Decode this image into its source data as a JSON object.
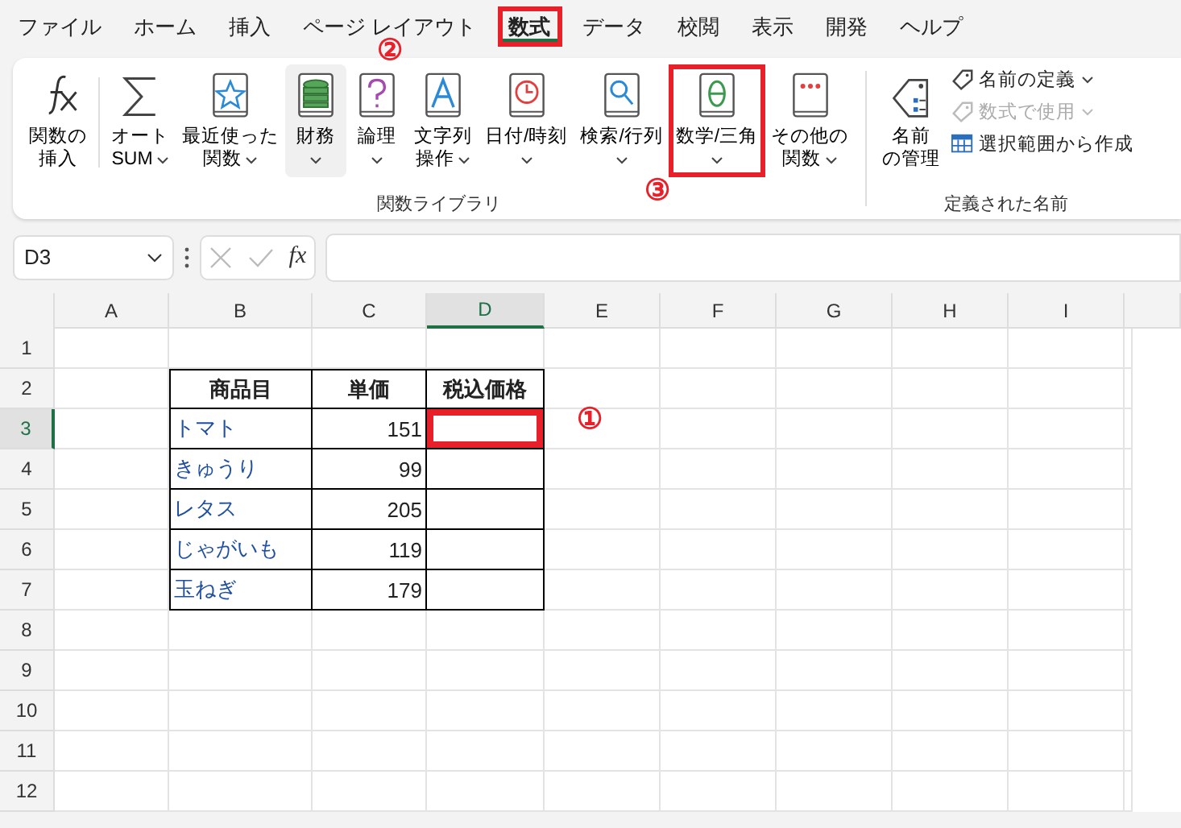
{
  "tabs": [
    {
      "label": "ファイル",
      "selected": false,
      "highlighted": false
    },
    {
      "label": "ホーム",
      "selected": false,
      "highlighted": false
    },
    {
      "label": "挿入",
      "selected": false,
      "highlighted": false
    },
    {
      "label": "ページ レイアウト",
      "selected": false,
      "highlighted": false
    },
    {
      "label": "数式",
      "selected": true,
      "highlighted": true
    },
    {
      "label": "データ",
      "selected": false,
      "highlighted": false
    },
    {
      "label": "校閲",
      "selected": false,
      "highlighted": false
    },
    {
      "label": "表示",
      "selected": false,
      "highlighted": false
    },
    {
      "label": "開発",
      "selected": false,
      "highlighted": false
    },
    {
      "label": "ヘルプ",
      "selected": false,
      "highlighted": false
    }
  ],
  "ribbon": {
    "groups": [
      {
        "label": "関数ライブラリ",
        "buttons": [
          {
            "kind": "fx",
            "lines": [
              "関数の",
              "挿入"
            ],
            "dropdown": false,
            "hovered": false,
            "highlighted": false
          },
          {
            "kind": "sum",
            "lines": [
              "オート",
              "SUM"
            ],
            "dropdown": true,
            "hovered": false,
            "highlighted": false
          },
          {
            "kind": "star",
            "lines": [
              "最近使った",
              "関数"
            ],
            "dropdown": true,
            "hovered": false,
            "highlighted": false
          },
          {
            "kind": "coins",
            "lines": [
              "財務"
            ],
            "dropdown": true,
            "hovered": true,
            "highlighted": false
          },
          {
            "kind": "question",
            "lines": [
              "論理"
            ],
            "dropdown": true,
            "hovered": false,
            "highlighted": false
          },
          {
            "kind": "letter",
            "lines": [
              "文字列",
              "操作"
            ],
            "dropdown": true,
            "hovered": false,
            "highlighted": false
          },
          {
            "kind": "clock",
            "lines": [
              "日付/時刻"
            ],
            "dropdown": true,
            "hovered": false,
            "highlighted": false
          },
          {
            "kind": "search",
            "lines": [
              "検索/行列"
            ],
            "dropdown": true,
            "hovered": false,
            "highlighted": false
          },
          {
            "kind": "theta",
            "lines": [
              "数学/三角"
            ],
            "dropdown": true,
            "hovered": false,
            "highlighted": true
          },
          {
            "kind": "dots",
            "lines": [
              "その他の",
              "関数"
            ],
            "dropdown": true,
            "hovered": false,
            "highlighted": false
          }
        ]
      },
      {
        "label": "定義された名前",
        "buttons": [
          {
            "kind": "tag",
            "lines": [
              "名前",
              "の管理"
            ],
            "dropdown": false,
            "hovered": false,
            "highlighted": false
          }
        ],
        "small_buttons": [
          {
            "kind": "tag",
            "label": "名前の定義",
            "dropdown": true,
            "disabled": false
          },
          {
            "kind": "tag",
            "label": "数式で使用",
            "dropdown": true,
            "disabled": true
          },
          {
            "kind": "grid",
            "label": "選択範囲から作成",
            "dropdown": false,
            "disabled": false
          }
        ]
      }
    ]
  },
  "formula_bar": {
    "name_box": "D3",
    "fx": "fx"
  },
  "sheet": {
    "columns": [
      {
        "label": "A",
        "selected": false
      },
      {
        "label": "B",
        "selected": false
      },
      {
        "label": "C",
        "selected": false
      },
      {
        "label": "D",
        "selected": true
      },
      {
        "label": "E",
        "selected": false
      },
      {
        "label": "F",
        "selected": false
      },
      {
        "label": "G",
        "selected": false
      },
      {
        "label": "H",
        "selected": false
      },
      {
        "label": "I",
        "selected": false
      }
    ],
    "rows": [
      {
        "label": "1",
        "selected": false
      },
      {
        "label": "2",
        "selected": false
      },
      {
        "label": "3",
        "selected": true
      },
      {
        "label": "4",
        "selected": false
      },
      {
        "label": "5",
        "selected": false
      },
      {
        "label": "6",
        "selected": false
      },
      {
        "label": "7",
        "selected": false
      },
      {
        "label": "8",
        "selected": false
      },
      {
        "label": "9",
        "selected": false
      },
      {
        "label": "10",
        "selected": false
      },
      {
        "label": "11",
        "selected": false
      },
      {
        "label": "12",
        "selected": false
      }
    ],
    "active_cell_highlighted": true,
    "table": {
      "headers": [
        "商品目",
        "単価",
        "税込価格"
      ],
      "rows": [
        {
          "name": "トマト",
          "price": "151"
        },
        {
          "name": "きゅうり",
          "price": "99"
        },
        {
          "name": "レタス",
          "price": "205"
        },
        {
          "name": "じゃがいも",
          "price": "119"
        },
        {
          "name": "玉ねぎ",
          "price": "179"
        }
      ]
    }
  },
  "annotations": [
    "①",
    "②",
    "③"
  ]
}
